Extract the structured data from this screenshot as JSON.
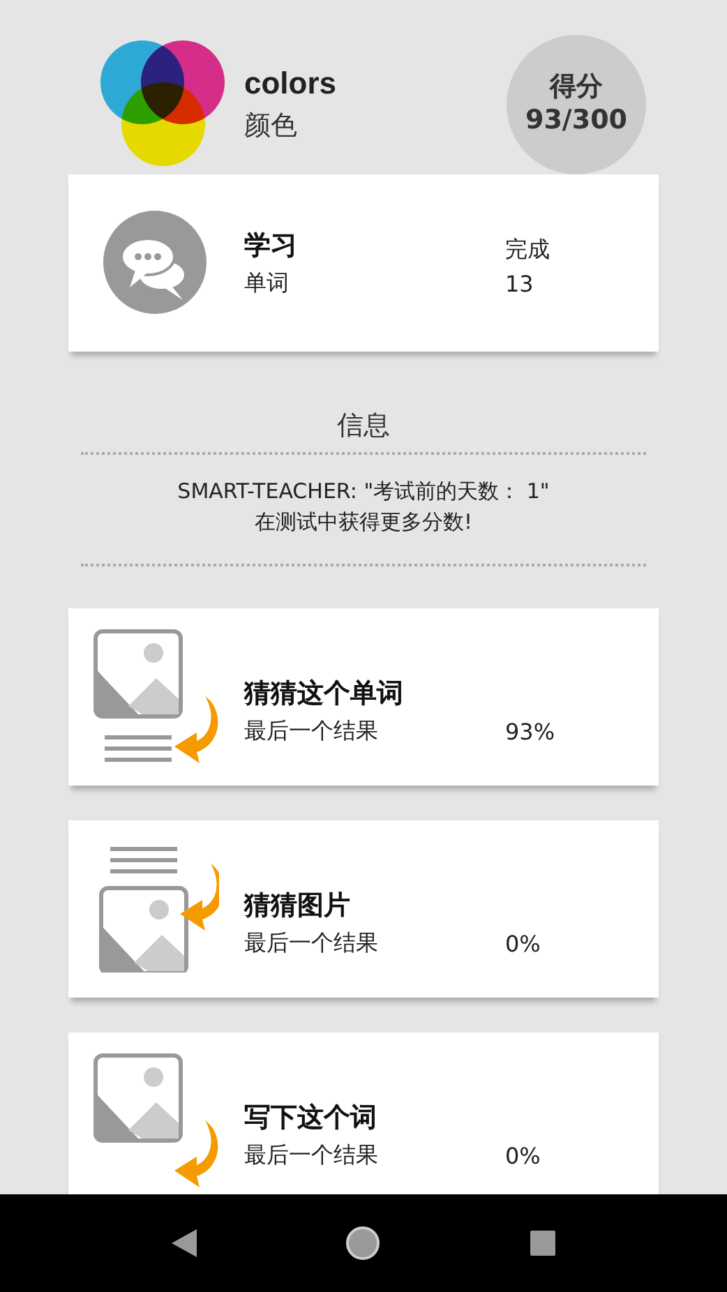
{
  "header": {
    "title": "colors",
    "subtitle": "颜色",
    "score_label": "得分",
    "score": "93/300"
  },
  "study": {
    "title": "学习",
    "subtitle": "单词",
    "status_label": "完成",
    "count": "13"
  },
  "info": {
    "title": "信息",
    "lines": [
      "SMART-TEACHER: \"考试前的天数： 1\"",
      "在测试中获得更多分数!"
    ]
  },
  "activities": [
    {
      "kind": "word",
      "title": "猜猜这个单词",
      "label": "最后一个结果",
      "result": "93%"
    },
    {
      "kind": "picture",
      "title": "猜猜图片",
      "label": "最后一个结果",
      "result": "0%"
    },
    {
      "kind": "write",
      "title": "写下这个词",
      "label": "最后一个结果",
      "result": "0%"
    }
  ]
}
